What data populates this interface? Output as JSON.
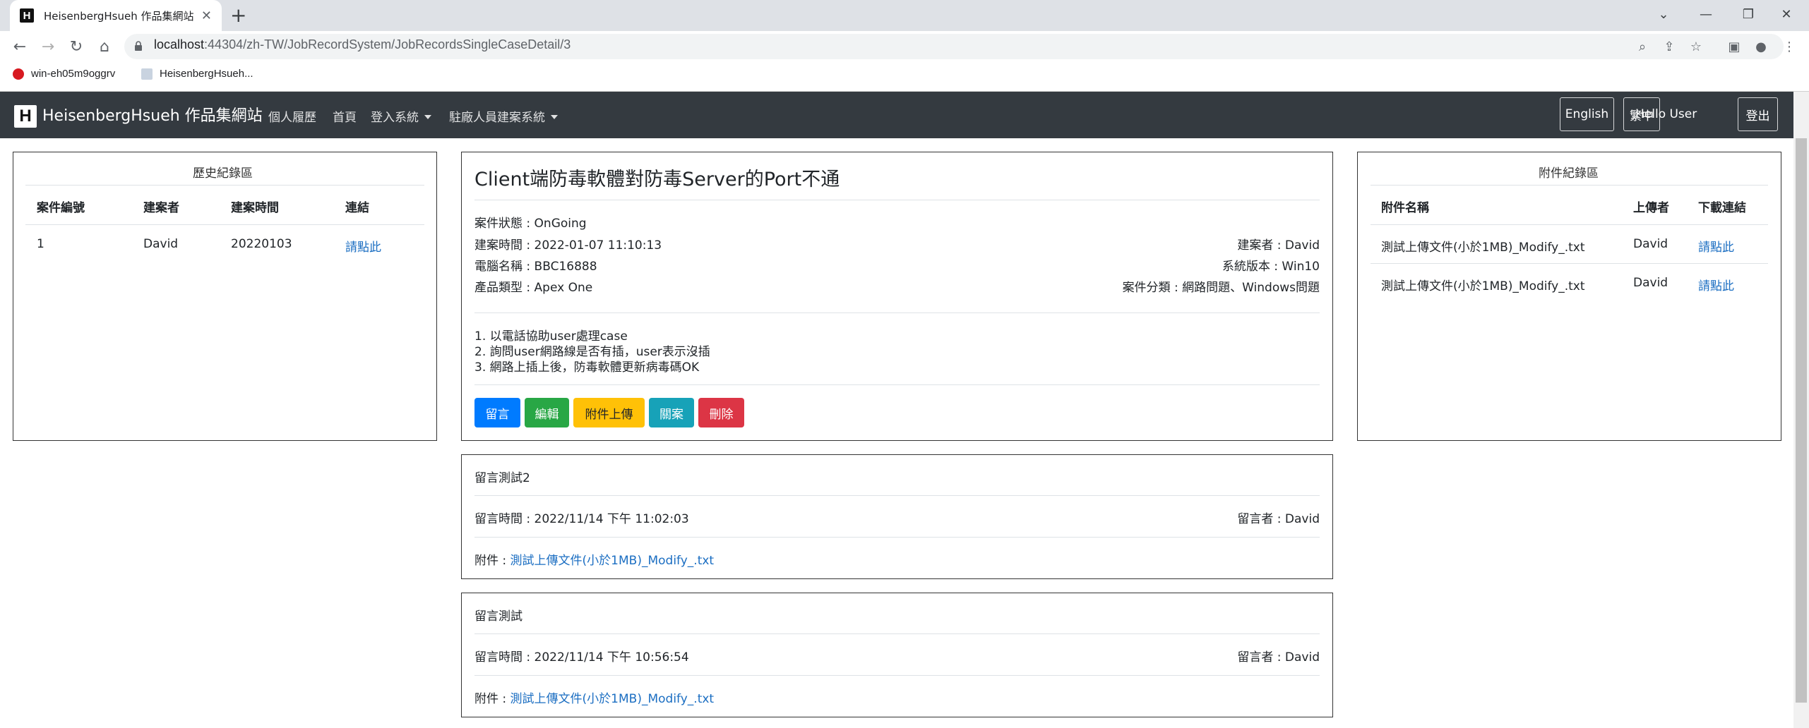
{
  "browser": {
    "tab_title": "HeisenbergHsueh 作品集網站",
    "favicon_letter": "H",
    "url_host": "localhost",
    "url_rest": ":44304/zh-TW/JobRecordSystem/JobRecordsSingleCaseDetail/3",
    "bookmarks": [
      "win-eh05m9oggrv",
      "HeisenbergHsueh..."
    ]
  },
  "navbar": {
    "logo_letter": "H",
    "brand": "HeisenbergHsueh 作品集網站",
    "links": [
      "個人履歷",
      "首頁",
      "登入系統",
      "駐廠人員建案系統"
    ],
    "lang_en": "English",
    "lang_zh": "繁中",
    "hello": "Hello User",
    "logout": "登出"
  },
  "history": {
    "title": "歷史紀錄區",
    "headers": [
      "案件編號",
      "建案者",
      "建案時間",
      "連結"
    ],
    "rows": [
      {
        "id": "1",
        "creator": "David",
        "time": "20220103",
        "link": "請點此"
      }
    ]
  },
  "case": {
    "title": "Client端防毒軟體對防毒Server的Port不通",
    "status_label": "案件狀態 : ",
    "status_value": "OnGoing",
    "created_label": "建案時間 : ",
    "created_value": "2022-01-07 11:10:13",
    "creator_label": "建案者 : ",
    "creator_value": "David",
    "pc_label": "電腦名稱 : ",
    "pc_value": "BBC16888",
    "os_label": "系統版本 : ",
    "os_value": "Win10",
    "product_label": "產品類型 : ",
    "product_value": "Apex One",
    "category_label": "案件分類 : 網路問題、",
    "category_value": "Windows問題",
    "steps": [
      "1. 以電話協助user處理case",
      "2. 詢問user網路線是否有插，user表示沒插",
      "3. 網路上插上後，防毒軟體更新病毒碼OK"
    ],
    "buttons": {
      "comment": "留言",
      "edit": "編輯",
      "upload": "附件上傳",
      "close": "關案",
      "delete": "刪除"
    }
  },
  "attachments": {
    "title": "附件紀錄區",
    "headers": [
      "附件名稱",
      "上傳者",
      "下載連結"
    ],
    "rows": [
      {
        "name": "測試上傳文件(小於1MB)_Modify_.txt",
        "uploader": "David",
        "link": "請點此"
      },
      {
        "name": "測試上傳文件(小於1MB)_Modify_.txt",
        "uploader": "David",
        "link": "請點此"
      }
    ]
  },
  "comments": [
    {
      "title": "留言測試2",
      "time_label": "留言時間 : ",
      "time_value": "2022/11/14 下午 11:02:03",
      "author_label": "留言者 : ",
      "author_value": "David",
      "file_label": "附件 : ",
      "file_value": "測試上傳文件(小於1MB)_Modify_.txt"
    },
    {
      "title": "留言測試",
      "time_label": "留言時間 : ",
      "time_value": "2022/11/14 下午 10:56:54",
      "author_label": "留言者 : ",
      "author_value": "David",
      "file_label": "附件 : ",
      "file_value": "測試上傳文件(小於1MB)_Modify_.txt"
    }
  ],
  "colors": {
    "navbar": "#343a40",
    "primary": "#007bff",
    "success": "#28a745",
    "warning": "#ffc107",
    "info": "#17a2b8",
    "danger": "#dc3545",
    "link": "#1b6ec2"
  }
}
